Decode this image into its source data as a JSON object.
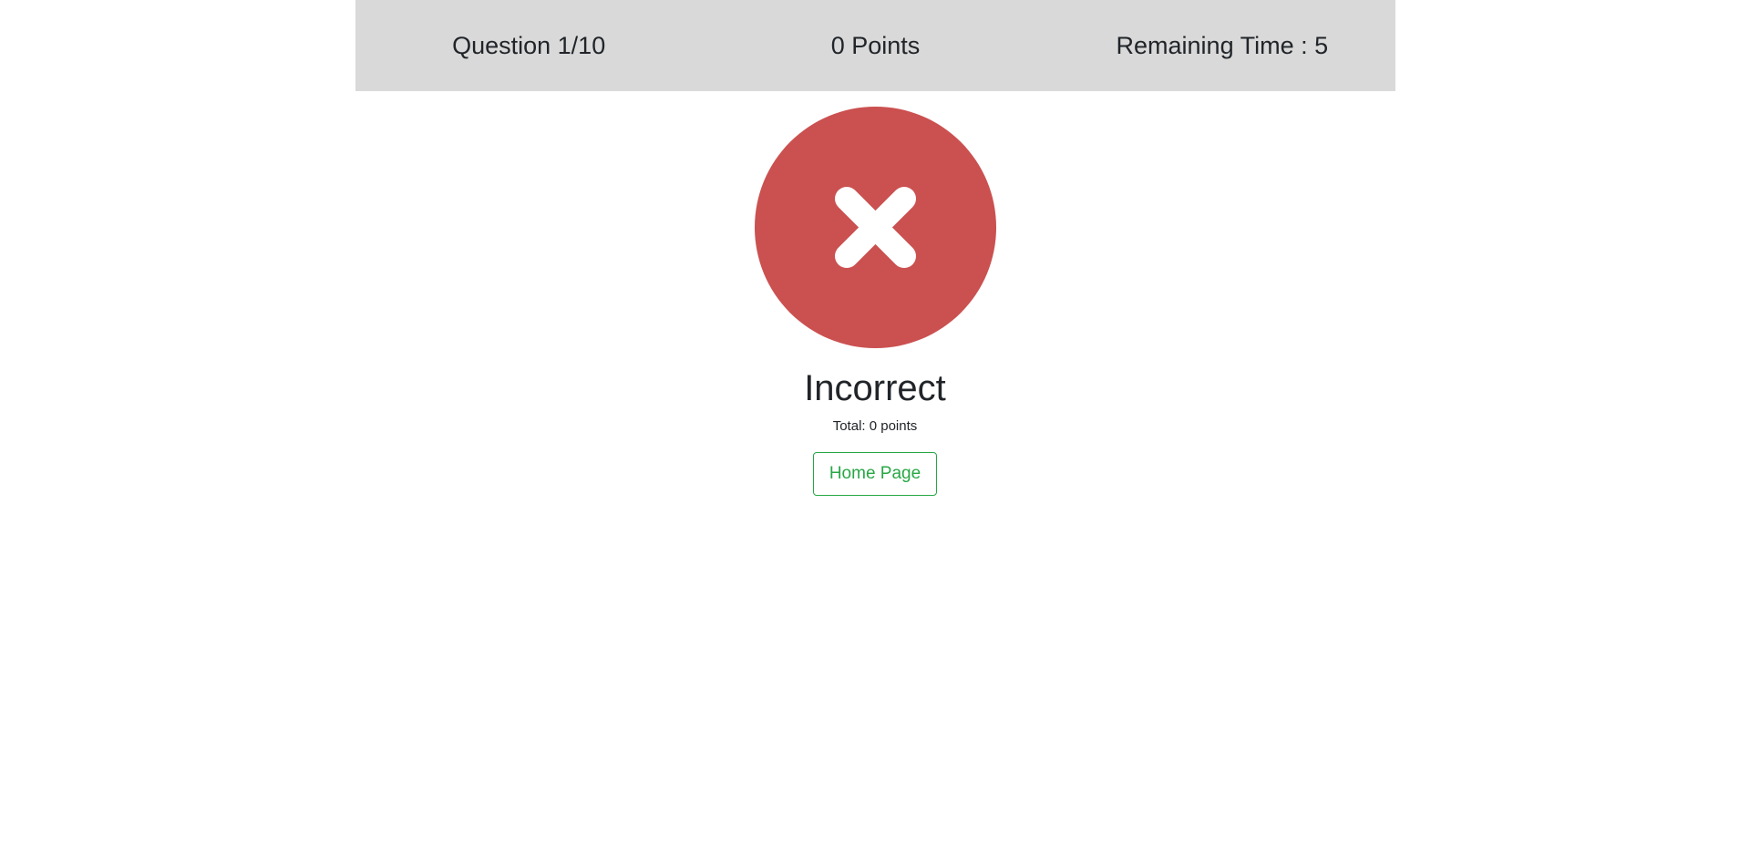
{
  "header": {
    "question": "Question 1/10",
    "points": "0 Points",
    "remaining_time": "Remaining Time : 5"
  },
  "result": {
    "icon": "close-icon",
    "icon_color": "#cb5050",
    "title": "Incorrect",
    "total": "Total: 0 points",
    "home_button_label": "Home Page",
    "button_color": "#28a745"
  }
}
